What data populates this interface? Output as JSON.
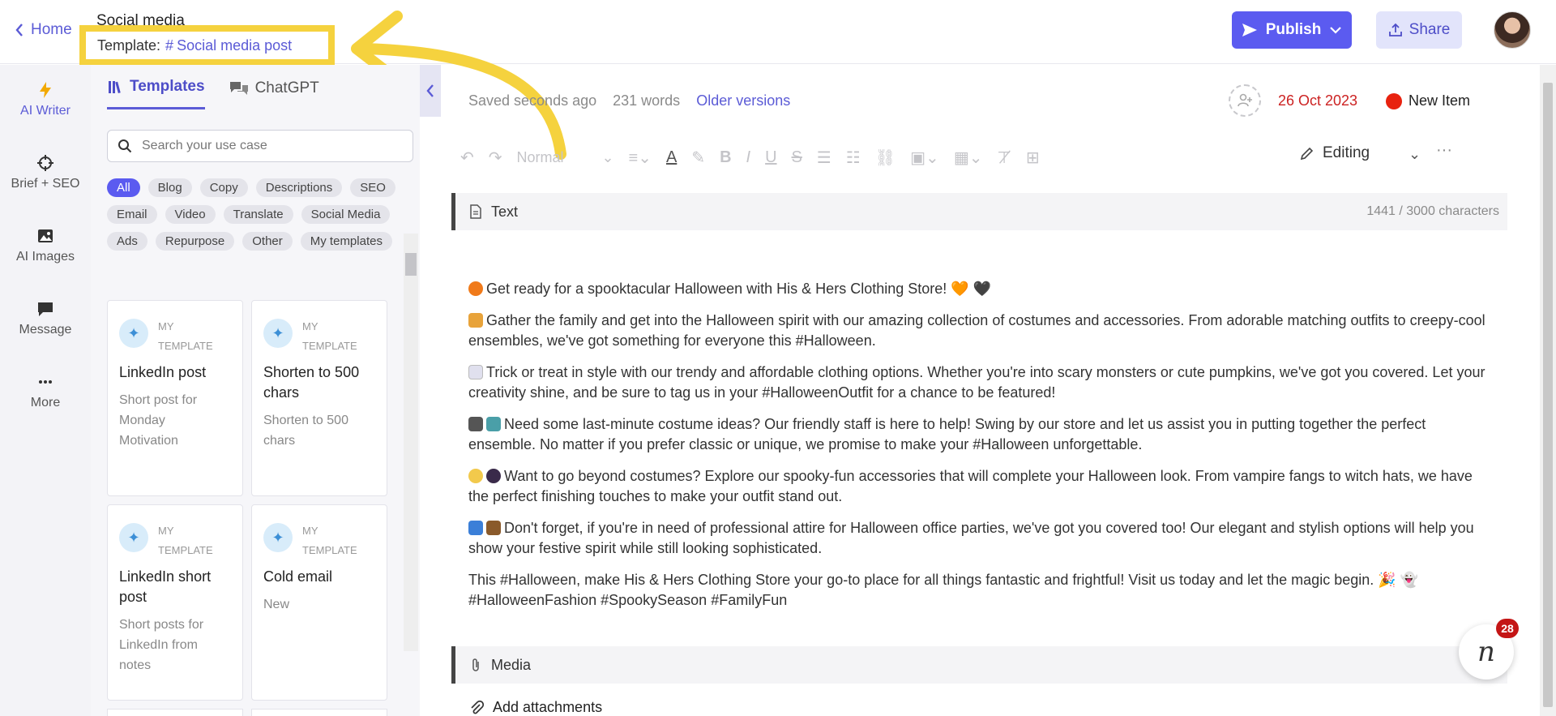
{
  "header": {
    "home_label": "Home",
    "doc_title": "Social media",
    "template_label": "Template:",
    "template_hash": "#",
    "template_name": "Social media post",
    "publish_label": "Publish",
    "share_label": "Share"
  },
  "rail": {
    "items": [
      {
        "label": "AI Writer",
        "icon": "lightning-icon"
      },
      {
        "label": "Brief + SEO",
        "icon": "crosshair-icon"
      },
      {
        "label": "AI Images",
        "icon": "image-icon"
      },
      {
        "label": "Message",
        "icon": "message-icon"
      },
      {
        "label": "More",
        "icon": "more-dots-icon"
      }
    ]
  },
  "panel": {
    "tabs": [
      {
        "label": "Templates"
      },
      {
        "label": "ChatGPT"
      }
    ],
    "search_placeholder": "Search your use case",
    "chips": [
      "All",
      "Blog",
      "Copy",
      "Descriptions",
      "SEO",
      "Email",
      "Video",
      "Translate",
      "Social Media",
      "Ads",
      "Repurpose",
      "Other",
      "My templates"
    ],
    "cards": [
      {
        "tag1": "MY",
        "tag2": "TEMPLATE",
        "title": "LinkedIn post",
        "desc": "Short post for Monday Motivation"
      },
      {
        "tag1": "MY",
        "tag2": "TEMPLATE",
        "title": "Shorten to 500 chars",
        "desc": "Shorten to 500 chars"
      },
      {
        "tag1": "MY",
        "tag2": "TEMPLATE",
        "title": "LinkedIn short post",
        "desc": "Short posts for LinkedIn from notes"
      },
      {
        "tag1": "MY",
        "tag2": "TEMPLATE",
        "title": "Cold email",
        "desc": "New"
      }
    ]
  },
  "editor": {
    "saved": "Saved seconds ago",
    "words": "231 words",
    "older_versions": "Older versions",
    "date": "26 Oct 2023",
    "status": "New Item",
    "toolbar_style": "Normal",
    "editing_label": "Editing",
    "text_section": "Text",
    "char_count": "1441 / 3000 characters",
    "media_section": "Media",
    "add_attachments": "Add attachments",
    "paragraphs": [
      {
        "emoji_colors": [
          "#f07a1a"
        ],
        "text": "Get ready for a spooktacular Halloween with His & Hers Clothing Store! 🧡 🖤"
      },
      {
        "emoji_colors": [
          "#e8a33a"
        ],
        "text": "Gather the family and get into the Halloween spirit with our amazing collection of costumes and accessories. From adorable matching outfits to creepy-cool ensembles, we've got something for everyone this #Halloween."
      },
      {
        "emoji_colors": [
          "#e0e0ee"
        ],
        "text": "Trick or treat in style with our trendy and affordable clothing options. Whether you're into scary monsters or cute pumpkins, we've got you covered. Let your creativity shine, and be sure to tag us in your #HalloweenOutfit for a chance to be featured!"
      },
      {
        "emoji_colors": [
          "#555555",
          "#4a9fa8"
        ],
        "text": "Need some last-minute costume ideas? Our friendly staff is here to help! Swing by our store and let us assist you in putting together the perfect ensemble. No matter if you prefer classic or unique, we promise to make your #Halloween unforgettable."
      },
      {
        "emoji_colors": [
          "#f2c94c",
          "#3a2a4a"
        ],
        "text": "Want to go beyond costumes? Explore our spooky-fun accessories that will complete your Halloween look. From vampire fangs to witch hats, we have the perfect finishing touches to make your outfit stand out."
      },
      {
        "emoji_colors": [
          "#3b7fd8",
          "#8a5a2b"
        ],
        "text": "Don't forget, if you're in need of professional attire for Halloween office parties, we've got you covered too! Our elegant and stylish options will help you show your festive spirit while still looking sophisticated."
      },
      {
        "emoji_colors": [],
        "text": "This #Halloween, make His & Hers Clothing Store your go-to place for all things fantastic and frightful! Visit us today and let the magic begin. 🎉 👻 #HalloweenFashion #SpookySeason #FamilyFun"
      }
    ]
  },
  "help": {
    "count": "28",
    "glyph": "n"
  },
  "colors": {
    "accent": "#5b5bf0",
    "highlight_box": "#f5d23e",
    "date_red": "#c22222",
    "status_dot": "#e8220f"
  }
}
